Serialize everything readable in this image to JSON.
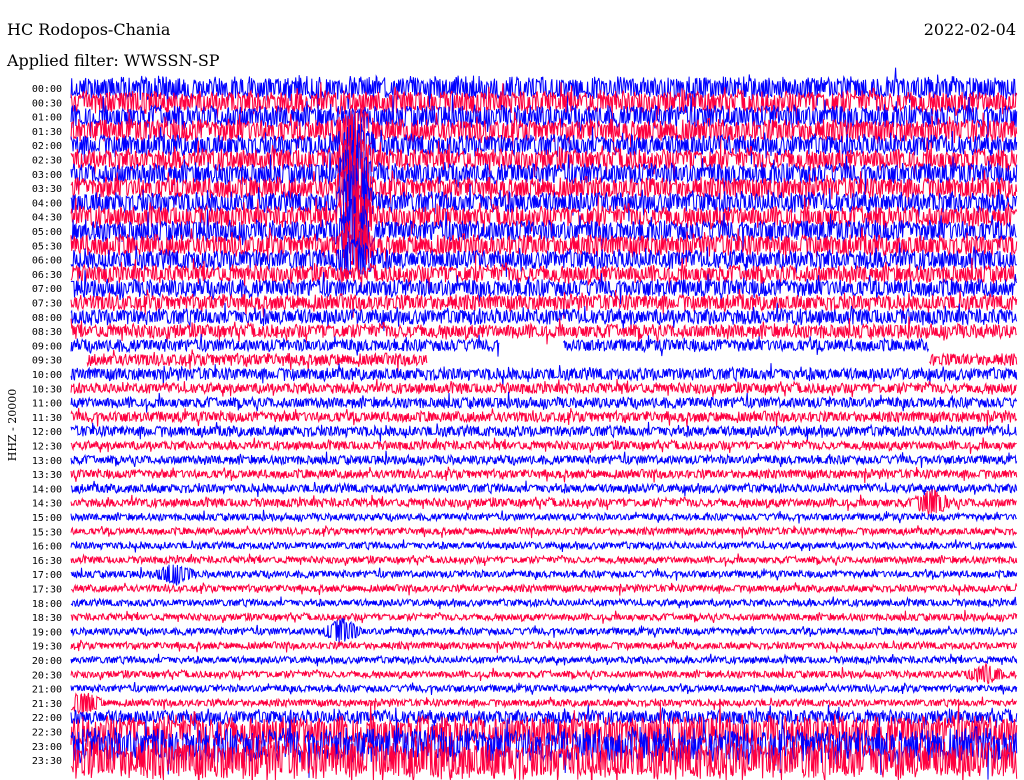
{
  "header": {
    "station": "HC Rodopos-Chania",
    "date": "2022-02-04",
    "filter_label": "Applied filter: WWSSN-SP"
  },
  "chart_data": {
    "type": "line",
    "title": "HC Rodopos-Chania",
    "ylabel": "HHZ - 20000",
    "xlabel": "",
    "x_range_minutes": [
      0,
      30
    ],
    "colors": [
      "#0000ff",
      "#ff0040"
    ],
    "rows": [
      "00:00",
      "00:30",
      "01:00",
      "01:30",
      "02:00",
      "02:30",
      "03:00",
      "03:30",
      "04:00",
      "04:30",
      "05:00",
      "05:30",
      "06:00",
      "06:30",
      "07:00",
      "07:30",
      "08:00",
      "08:30",
      "09:00",
      "09:30",
      "10:00",
      "10:30",
      "11:00",
      "11:30",
      "12:00",
      "12:30",
      "13:00",
      "13:30",
      "14:00",
      "14:30",
      "15:00",
      "15:30",
      "16:00",
      "16:30",
      "17:00",
      "17:30",
      "18:00",
      "18:30",
      "19:00",
      "19:30",
      "20:00",
      "20:30",
      "21:00",
      "21:30",
      "22:00",
      "22:30",
      "23:00",
      "23:30"
    ],
    "amplitudes": [
      13,
      13,
      13,
      13,
      12,
      12,
      12,
      12,
      12,
      12,
      12,
      12,
      11,
      10,
      10,
      9,
      9,
      8,
      7,
      7,
      7,
      6,
      6,
      6,
      6,
      5,
      5,
      5,
      5,
      5,
      4,
      4,
      4,
      4,
      4,
      4,
      4,
      4,
      4,
      4,
      4,
      4,
      4,
      4,
      8,
      18,
      20,
      22
    ],
    "gaps": [
      {
        "row": 18,
        "from_min": 13.6,
        "to_min": 15.6
      },
      {
        "row": 18,
        "from_min": 27.2,
        "to_min": 30
      },
      {
        "row": 19,
        "from_min": 0,
        "to_min": 0.5
      },
      {
        "row": 19,
        "from_min": 11.3,
        "to_min": 27.2
      }
    ],
    "events": [
      {
        "row": 3,
        "minute": 9.0,
        "amplitude": 14
      },
      {
        "row": 4,
        "minute": 9.0,
        "amplitude": 18
      },
      {
        "row": 5,
        "minute": 9.0,
        "amplitude": 20
      },
      {
        "row": 6,
        "minute": 9.0,
        "amplitude": 26
      },
      {
        "row": 7,
        "minute": 9.0,
        "amplitude": 30
      },
      {
        "row": 8,
        "minute": 9.0,
        "amplitude": 30
      },
      {
        "row": 9,
        "minute": 9.0,
        "amplitude": 28
      },
      {
        "row": 10,
        "minute": 9.0,
        "amplitude": 26
      },
      {
        "row": 11,
        "minute": 9.0,
        "amplitude": 22
      },
      {
        "row": 12,
        "minute": 9.0,
        "amplitude": 14
      },
      {
        "row": 29,
        "minute": 27.3,
        "amplitude": 10
      },
      {
        "row": 34,
        "minute": 3.3,
        "amplitude": 9
      },
      {
        "row": 38,
        "minute": 8.6,
        "amplitude": 10
      },
      {
        "row": 43,
        "minute": 0.4,
        "amplitude": 9
      },
      {
        "row": 41,
        "minute": 29.0,
        "amplitude": 7
      }
    ]
  }
}
